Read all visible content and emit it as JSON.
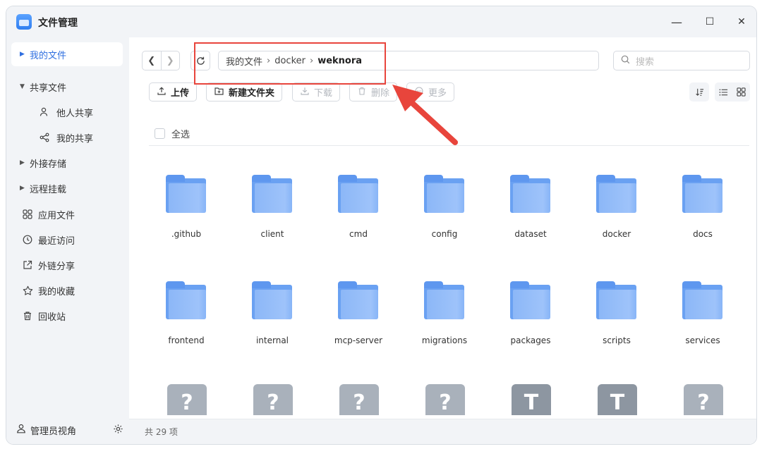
{
  "window": {
    "title": "文件管理"
  },
  "window_controls": {
    "minimize": "—",
    "maximize": "☐",
    "close": "✕"
  },
  "sidebar": {
    "items": [
      {
        "label": "我的文件",
        "active": true
      },
      {
        "label": "共享文件"
      },
      {
        "label": "他人共享"
      },
      {
        "label": "我的共享"
      },
      {
        "label": "外接存储"
      },
      {
        "label": "远程挂载"
      },
      {
        "label": "应用文件"
      },
      {
        "label": "最近访问"
      },
      {
        "label": "外链分享"
      },
      {
        "label": "我的收藏"
      },
      {
        "label": "回收站"
      }
    ],
    "footer_label": "管理员视角"
  },
  "path": {
    "segments": [
      "我的文件",
      "docker",
      "weknora"
    ],
    "separator": "›"
  },
  "search": {
    "placeholder": "搜索"
  },
  "toolbar": {
    "upload": "上传",
    "new_folder": "新建文件夹",
    "download": "下载",
    "delete": "删除",
    "more": "更多"
  },
  "select_all": "全选",
  "files": [
    {
      "name": ".github",
      "type": "folder"
    },
    {
      "name": "client",
      "type": "folder"
    },
    {
      "name": "cmd",
      "type": "folder"
    },
    {
      "name": "config",
      "type": "folder"
    },
    {
      "name": "dataset",
      "type": "folder"
    },
    {
      "name": "docker",
      "type": "folder"
    },
    {
      "name": "docs",
      "type": "folder"
    },
    {
      "name": "frontend",
      "type": "folder"
    },
    {
      "name": "internal",
      "type": "folder"
    },
    {
      "name": "mcp-server",
      "type": "folder"
    },
    {
      "name": "migrations",
      "type": "folder"
    },
    {
      "name": "packages",
      "type": "folder"
    },
    {
      "name": "scripts",
      "type": "folder"
    },
    {
      "name": "services",
      "type": "folder"
    },
    {
      "name": "",
      "type": "unknown-file",
      "glyph": "?"
    },
    {
      "name": "",
      "type": "unknown-file",
      "glyph": "?"
    },
    {
      "name": "",
      "type": "unknown-file",
      "glyph": "?"
    },
    {
      "name": "",
      "type": "unknown-file",
      "glyph": "?"
    },
    {
      "name": "",
      "type": "text-file",
      "glyph": "T"
    },
    {
      "name": "",
      "type": "text-file",
      "glyph": "T"
    },
    {
      "name": "",
      "type": "unknown-file",
      "glyph": "?"
    }
  ],
  "status": {
    "total": "共 29 项"
  },
  "annotation": {
    "color": "#e8453c"
  }
}
